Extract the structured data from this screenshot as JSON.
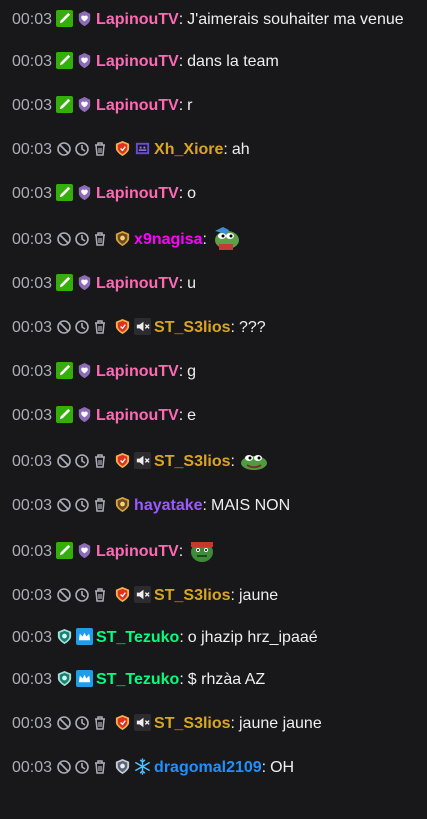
{
  "messages": [
    {
      "time": "00:03",
      "badges": [
        "pencil-badge",
        "heart-badge"
      ],
      "user": "LapinouTV",
      "color": "#ff69b4",
      "text": "J'aimerais souhaiter ma venue",
      "mod": false
    },
    {
      "time": "00:03",
      "badges": [
        "pencil-badge",
        "heart-badge"
      ],
      "user": "LapinouTV",
      "color": "#ff69b4",
      "text": "dans la team",
      "mod": false
    },
    {
      "time": "00:03",
      "badges": [
        "pencil-badge",
        "heart-badge"
      ],
      "user": "LapinouTV",
      "color": "#ff69b4",
      "text": "r",
      "mod": false
    },
    {
      "time": "00:03",
      "badges": [
        "red-shield-badge",
        "game-badge"
      ],
      "user": "Xh_Xiore",
      "color": "#daa520",
      "text": "ah",
      "mod": true
    },
    {
      "time": "00:03",
      "badges": [
        "pencil-badge",
        "heart-badge"
      ],
      "user": "LapinouTV",
      "color": "#ff69b4",
      "text": "o",
      "mod": false
    },
    {
      "time": "00:03",
      "badges": [
        "gold-shield-badge"
      ],
      "user": "x9nagisa",
      "color": "#ff00ff",
      "text": "",
      "emote": "pepe-emote",
      "mod": true
    },
    {
      "time": "00:03",
      "badges": [
        "pencil-badge",
        "heart-badge"
      ],
      "user": "LapinouTV",
      "color": "#ff69b4",
      "text": "u",
      "mod": false
    },
    {
      "time": "00:03",
      "badges": [
        "red-shield-badge",
        "mute-badge"
      ],
      "user": "ST_S3lios",
      "color": "#daa520",
      "text": "???",
      "mod": true
    },
    {
      "time": "00:03",
      "badges": [
        "pencil-badge",
        "heart-badge"
      ],
      "user": "LapinouTV",
      "color": "#ff69b4",
      "text": "g",
      "mod": false
    },
    {
      "time": "00:03",
      "badges": [
        "pencil-badge",
        "heart-badge"
      ],
      "user": "LapinouTV",
      "color": "#ff69b4",
      "text": "e",
      "mod": false
    },
    {
      "time": "00:03",
      "badges": [
        "red-shield-badge",
        "mute-badge"
      ],
      "user": "ST_S3lios",
      "color": "#daa520",
      "text": "",
      "emote": "frog-emote",
      "mod": true
    },
    {
      "time": "00:03",
      "badges": [
        "gold-shield-badge"
      ],
      "user": "hayatake",
      "color": "#9b59ff",
      "text": "MAIS NON",
      "mod": true
    },
    {
      "time": "00:03",
      "badges": [
        "pencil-badge",
        "heart-badge"
      ],
      "user": "LapinouTV",
      "color": "#ff69b4",
      "text": "",
      "emote": "goblin-emote",
      "mod": false
    },
    {
      "time": "00:03",
      "badges": [
        "red-shield-badge",
        "mute-badge"
      ],
      "user": "ST_S3lios",
      "color": "#daa520",
      "text": "jaune",
      "mod": true
    },
    {
      "time": "00:03",
      "badges": [
        "teal-shield-badge",
        "crown-badge"
      ],
      "user": "ST_Tezuko",
      "color": "#00ff7f",
      "text": "o jhazip hrz_ipaaé",
      "mod": false
    },
    {
      "time": "00:03",
      "badges": [
        "teal-shield-badge",
        "crown-badge"
      ],
      "user": "ST_Tezuko",
      "color": "#00ff7f",
      "text": "$ rhzàa AZ",
      "mod": false
    },
    {
      "time": "00:03",
      "badges": [
        "red-shield-badge",
        "mute-badge"
      ],
      "user": "ST_S3lios",
      "color": "#daa520",
      "text": "jaune jaune",
      "mod": true
    },
    {
      "time": "00:03",
      "badges": [
        "silver-shield-badge",
        "snowflake-badge"
      ],
      "user": "dragomal2109",
      "color": "#1e90ff",
      "text": "OH",
      "mod": true
    }
  ]
}
